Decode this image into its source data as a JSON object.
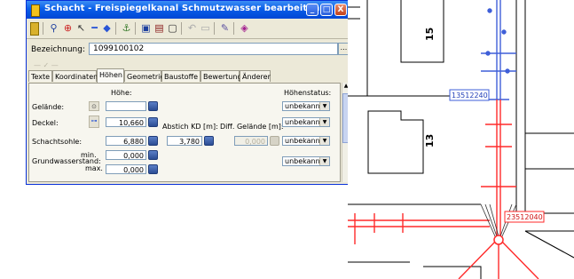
{
  "window": {
    "title": "Schacht - Freispiegelkanal Schmutzwasser bearbeiten",
    "buttons": {
      "minimize": "_",
      "maximize": "□",
      "close": "X"
    }
  },
  "toolbar": {
    "items": [
      "door-icon",
      "zoom-icon",
      "crosshair-icon",
      "pointer-icon",
      "line-icon",
      "diamond-icon",
      "network-icon",
      "layers-icon",
      "copy-icon",
      "reset-icon",
      "save-icon",
      "settings-icon",
      "color-icon"
    ]
  },
  "bezeichnung": {
    "label": "Bezeichnung:",
    "value": "1099100102",
    "button": "..."
  },
  "faded_text": "— ✓ —",
  "tabs": [
    "Texte",
    "Koordinaten",
    "Höhen",
    "Geometrie",
    "Baustoffe",
    "Bewertung",
    "Änderer"
  ],
  "active_tab": "Höhen",
  "panel": {
    "hoehe_header": "Höhe:",
    "hoehenstatus_header": "Höhenstatus:",
    "rows": {
      "gelaende": {
        "label": "Gelände:",
        "value": "",
        "status": "unbekannte"
      },
      "deckel": {
        "label": "Deckel:",
        "value": "10,660",
        "status": "unbekannte"
      },
      "schachtsohle": {
        "label": "Schachtsohle:",
        "value": "6,880",
        "status": "unbekannte"
      }
    },
    "abstich_label": "Abstich KD [m]:",
    "abstich_value": "3,780",
    "diff_label": "Diff. Gelände [m]:",
    "diff_value": "0,000",
    "grundwasser": {
      "label": "Grundwasserstand:",
      "min_label": "min.",
      "max_label": "max.",
      "min_value": "0,000",
      "max_value": "0,000",
      "status": "unbekannte"
    }
  },
  "map": {
    "parcels": [
      "15",
      "13"
    ],
    "manholes": [
      "13512240",
      "23512040"
    ],
    "colors": {
      "pipe": "#ff2a2a",
      "pipe_blue": "#3f5fd8",
      "parcel": "#000000"
    }
  }
}
